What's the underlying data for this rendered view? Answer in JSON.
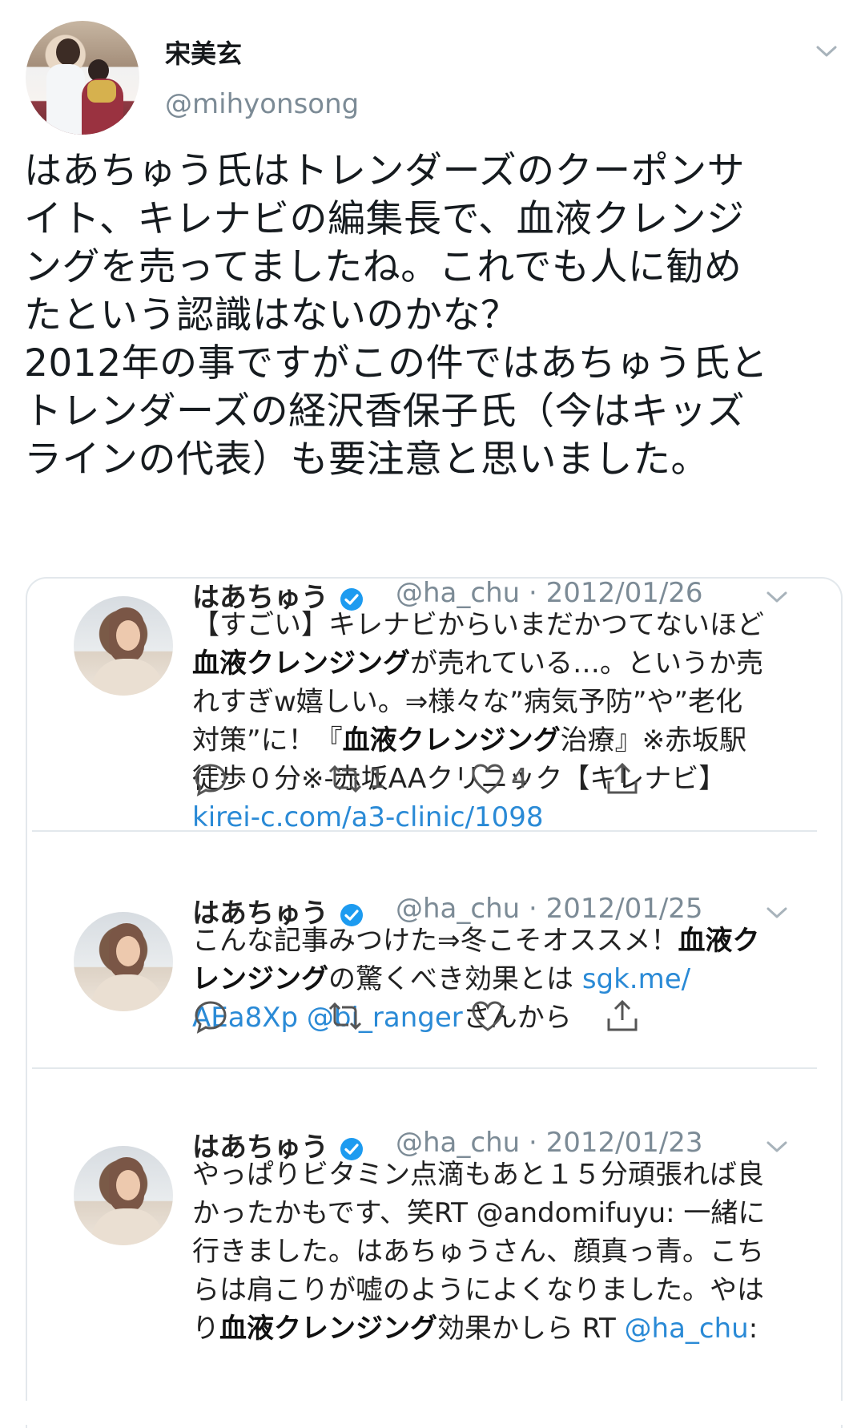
{
  "author": {
    "display_name": "宋美玄",
    "handle": "@mihyonsong"
  },
  "tweet": {
    "lines": [
      "はあちゅう氏はトレンダーズのクーポンサ",
      "イト、キレナビの編集長で、血液クレンジ",
      "ングを売ってましたね。これでも人に勧め",
      "たという認識はないのかな？",
      "2012年の事ですがこの件ではあちゅう氏と",
      "トレンダーズの経沢香保子氏（今はキッズ",
      "ラインの代表）も要注意と思いました。"
    ]
  },
  "quoted": [
    {
      "name": "はあちゅう",
      "meta": "@ha_chu · 2012/01/26",
      "lines": [
        [
          {
            "t": "【すごい】キレナビからいまだかつてないほど"
          }
        ],
        [
          {
            "t": "血液クレンジング",
            "b": true
          },
          {
            "t": "が売れている…。というか売"
          }
        ],
        [
          {
            "t": "れすぎw嬉しい。⇒様々な”病気予防”や”老化"
          }
        ],
        [
          {
            "t": "対策”に！『"
          },
          {
            "t": "血液クレンジング",
            "b": true
          },
          {
            "t": "治療』※赤坂駅"
          }
        ],
        [
          {
            "t": "徒歩０分※-赤坂AAクリニック【キレナビ】"
          }
        ],
        [
          {
            "t": "kirei-c.com/a3-clinic/1098",
            "link": true
          }
        ]
      ],
      "retweets": "1",
      "likes": "4"
    },
    {
      "name": "はあちゅう",
      "meta": "@ha_chu · 2012/01/25",
      "lines": [
        [
          {
            "t": "こんな記事みつけた⇒冬こそオススメ！"
          },
          {
            "t": "血液ク",
            "b": true
          }
        ],
        [
          {
            "t": "レンジング",
            "b": true
          },
          {
            "t": "の驚くべき効果とは "
          },
          {
            "t": "sgk.me/",
            "link": true
          }
        ],
        [
          {
            "t": "AEa8Xp",
            "link": true
          },
          {
            "t": " "
          },
          {
            "t": "@bi_ranger",
            "link": true
          },
          {
            "t": "さんから"
          }
        ]
      ],
      "retweets": "",
      "likes": ""
    },
    {
      "name": "はあちゅう",
      "meta": "@ha_chu · 2012/01/23",
      "lines": [
        [
          {
            "t": "やっぱりビタミン点滴もあと１５分頑張れば良"
          }
        ],
        [
          {
            "t": "かったかもです、笑RT @andomifuyu: 一緒に"
          }
        ],
        [
          {
            "t": "行きました。はあちゅうさん、顔真っ青。こち"
          }
        ],
        [
          {
            "t": "らは肩こりが嘘のようによくなりました。やは"
          }
        ],
        [
          {
            "t": "り"
          },
          {
            "t": "血液クレンジング",
            "b": true
          },
          {
            "t": "効果かしら RT "
          },
          {
            "t": "@ha_chu",
            "link": true
          },
          {
            "t": ":"
          }
        ]
      ]
    }
  ],
  "icons": {
    "reply": "reply-icon",
    "retweet": "retweet-icon",
    "like": "heart-icon",
    "share": "share-icon",
    "verified": "verified-badge-icon",
    "more": "chevron-down-icon"
  },
  "colors": {
    "link": "#2a8ad6",
    "muted": "#7c8b96",
    "verified": "#1d9bf0"
  }
}
